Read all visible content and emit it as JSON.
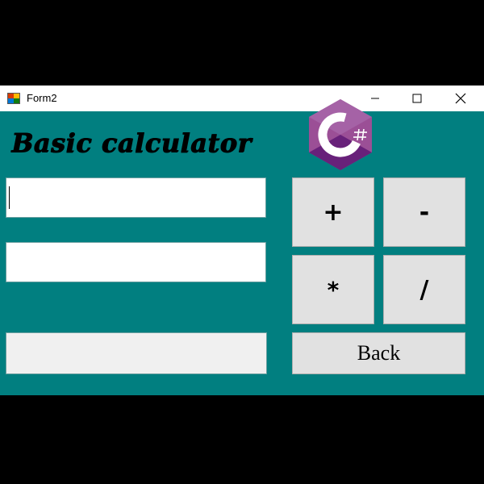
{
  "window": {
    "title": "Form2",
    "controls": {
      "minimize": "minimize",
      "maximize": "maximize",
      "close": "close"
    }
  },
  "form": {
    "heading": "Basic calculator",
    "input_a": {
      "value": ""
    },
    "input_b": {
      "value": ""
    },
    "result": {
      "value": ""
    }
  },
  "buttons": {
    "add": "+",
    "subtract": "-",
    "multiply": "*",
    "divide": "/",
    "back": "Back"
  },
  "colors": {
    "form_background": "#017f80",
    "button_face": "#e1e1e1",
    "logo_purple": "#9b4f96"
  },
  "icons": {
    "app": "winforms-app-icon",
    "logo": "csharp-logo"
  }
}
